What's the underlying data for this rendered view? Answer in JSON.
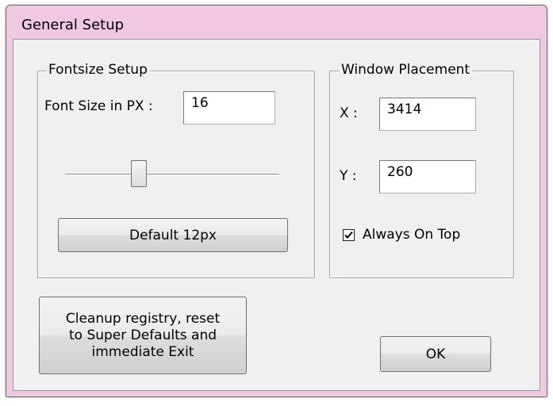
{
  "window": {
    "title": "General Setup"
  },
  "fontsize_group": {
    "legend": "Fontsize Setup",
    "font_size_label": "Font Size in PX :",
    "font_size_value": "16",
    "slider_level_fraction": 0.33,
    "default_button_label": "Default 12px"
  },
  "placement_group": {
    "legend": "Window Placement",
    "x_label": "X :",
    "x_value": "3414",
    "y_label": "Y :",
    "y_value": "260",
    "always_on_top_label": "Always On Top",
    "always_on_top_checked": true
  },
  "buttons": {
    "cleanup_line1": "Cleanup registry, reset",
    "cleanup_line2": "to Super Defaults and",
    "cleanup_line3": "immediate Exit",
    "ok_label": "OK"
  },
  "colors": {
    "titlebar": "#f0c8e0",
    "client_bg": "#f0f0f0"
  }
}
